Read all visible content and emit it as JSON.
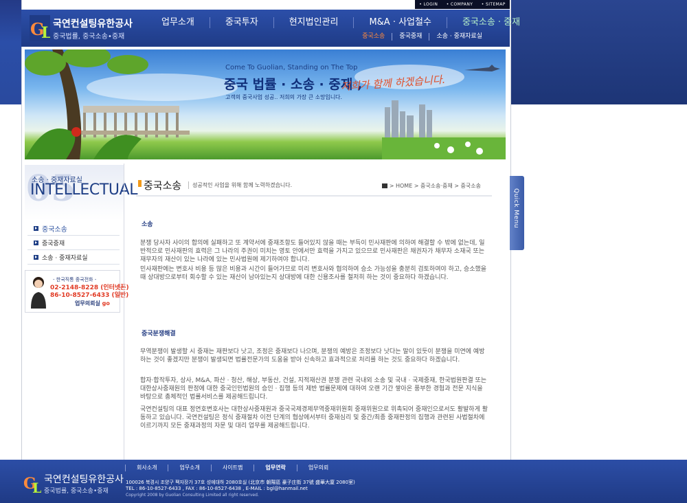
{
  "brand": {
    "name": "국연컨설팅유한공사",
    "tagline": "중국법률, 중국소송•중재"
  },
  "topbar": [
    "• LOGIN",
    "• COMPANY",
    "• SITEMAP"
  ],
  "gnb": [
    "업무소개",
    "중국투자",
    "현지법인관리",
    "M&A · 사업철수",
    "중국소송 · 중재"
  ],
  "snb": [
    "중국소송",
    "중국중재",
    "소송 · 중재자료실"
  ],
  "banner": {
    "tagline": "Come To Guolian, Standing on The Top",
    "title": "중국 법률 · 소송 · 중재 ,",
    "script": "저희가 함께 하겠습니다.",
    "desc": "고객의 중국사업 성공.. 저희의 가장 큰 소망입니다."
  },
  "lnb": {
    "number": "05",
    "title": "소송 · 중재자료실",
    "english": "INTELLECTUAL",
    "items": [
      "중국소송",
      "중국중재",
      "소송 · 중재자료실"
    ]
  },
  "contact": {
    "label": "- 한국직통 중국전화 -",
    "phone1": "02-2148-8228 (인터넷폰)",
    "phone2": "86-10-8527-6433 (일반)",
    "cta_text": "업무의뢰실",
    "cta_go": "go"
  },
  "page": {
    "title": "중국소송",
    "subtitle": "성공적인 사업을 위해 함께 노력하겠습니다.",
    "breadcrumb": "> HOME > 중국소송·중재 > 중국소송"
  },
  "sections": [
    {
      "title": "소송",
      "paragraphs": [
        "분쟁 당사자 사이의 합의에 실패하고 또 계약서에 중재조항도 들어있지 않을 때는 부득이 민사재판에 의하여 해결할 수 밖에 없는데, 일반적으로 민사재판의 효력은 그 나라의 주권이 미치는 영토 안에서만 효력을 가지고 있으므로 민사재판은 채권자가 채무자 소재국 또는 재무자의 재산이 있는 나라에 있는 민사법원에 제기하여야 합니다.",
        "민사재판에는 변호사 비용 등 많은 비용과 시간이 들어가므로 미리 변호사와 협의하여 승소 가능성을 충분히 검토하여야 하고, 승소했을 때 상대방으로부터 회수할 수 있는 재산이 남아있는지 상대방에 대한 신용조사를 철저히 하는 것이 중요하다 하겠습니다."
      ]
    },
    {
      "title": "중국분쟁해결",
      "paragraphs": [
        "무역분쟁이 발생할 시 중재는 재판보다 낫고, 조정은 중재보다 나으며, 분쟁의 예방은 조정보다 낫다는 말이 있듯이 분쟁을 미연에 예방하는 것이 좋겠지만 분쟁이 발생되면 법률전문가의 도움을 받아 신속하고 효과적으로 처리를 하는 것도 중요하다 하겠습니다.",
        "합자·합작투자, 상사, M&A, 파산 · 청산, 해상, 부동산, 건설, 지적재산권 분쟁 관련 국내외 소송 및 국내 · 국제중재, 한국법원판결 또는 대한상사중재원의 판정에 대한 중국인민법원의 승인 · 집행 등의 제반 법률문제에 대하여 오랜 기간 쌓아온 풍부한 경험과 전문 지식을 바탕으로 총체적인 법률서비스를 제공해드립니다.",
        "국연컨설팅의 대표 정연호변호사는 대한상사중재원과 중국국제경제무역중재위원회 중재위원으로 위촉되어 중재인으로서도 활발하게 활동하고 있습니다.  국연컨설팅은 정식 중재절차 이전 단계의 협상에서부터 중재심리 및 중간/최종 중재판정의 집행과 관련된 사법절차에 이르기까지 모든 중재과정의 자문 및 대리 업무를 제공해드립니다."
      ]
    }
  ],
  "quick_menu": "Quick Menu",
  "footer": {
    "nav": [
      "회사소개",
      "업무소개",
      "사이트맵",
      "업무연락",
      "업무의뢰"
    ],
    "address": "100026 북경시 조양구 팩자장가 37호 성예대하 2080호실 (北京市 朝陽區 豪子庄街 37號 盛華大廈 2080室)",
    "tel": "TEL : 86-10-8527-6433 , FAX : 86-10-8527-6438 , E-MAIL : bgl@hanmail.net",
    "copyright": "Copyright 2008 by Guolian Consulting Limited all right reserved."
  },
  "colors": {
    "navy": "#1f3b86",
    "accent_orange": "#ff8a3c",
    "accent_green": "#b8f2c8",
    "phone_red": "#e13a24"
  }
}
